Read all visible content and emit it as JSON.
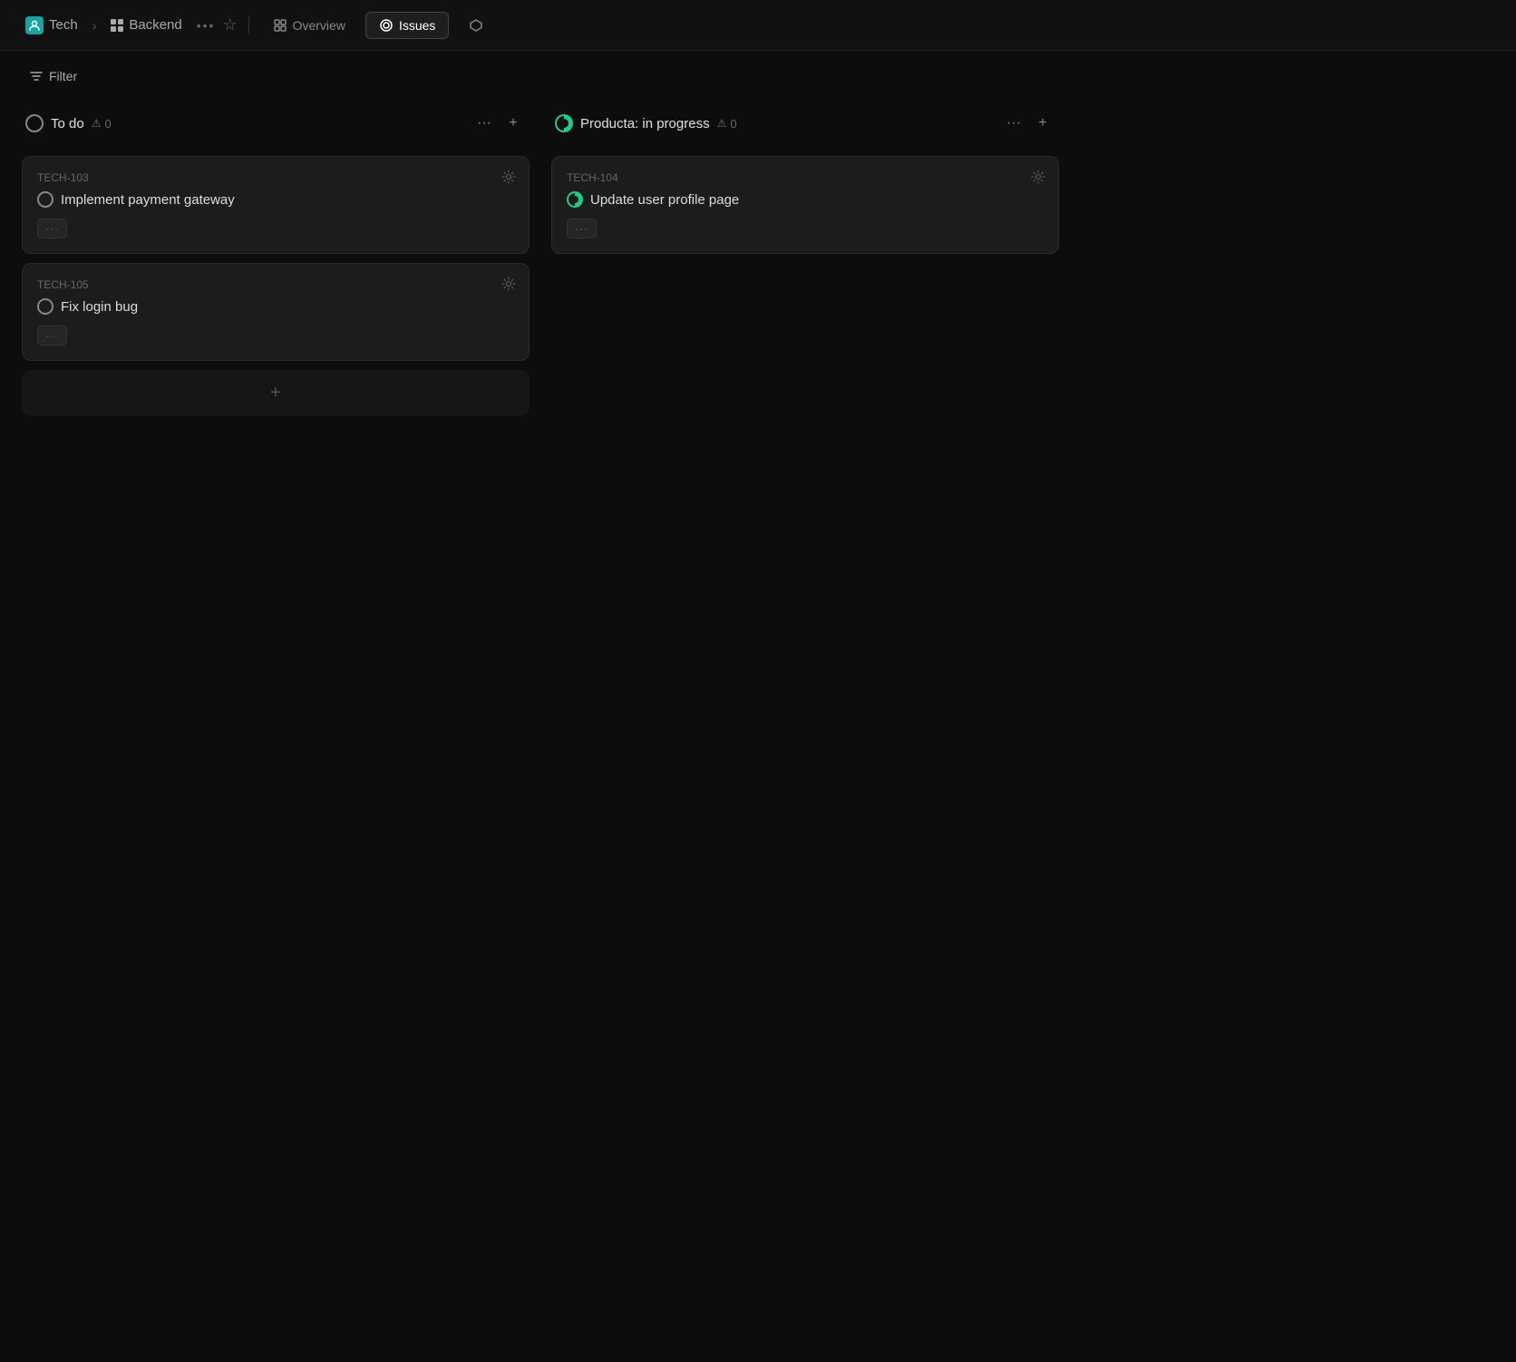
{
  "nav": {
    "team_icon": "T",
    "team_label": "Tech",
    "project_label": "Backend",
    "more_label": "•••",
    "star_label": "☆",
    "overview_label": "Overview",
    "issues_label": "Issues",
    "deploy_label": "⬡"
  },
  "filter": {
    "label": "Filter",
    "icon": "≡"
  },
  "columns": [
    {
      "id": "todo",
      "status_type": "circle",
      "title": "To do",
      "warning_count": "0",
      "cards": [
        {
          "id": "TECH-103",
          "status_type": "circle",
          "title": "Implement payment gateway",
          "meta": "···"
        },
        {
          "id": "TECH-105",
          "status_type": "circle",
          "title": "Fix login bug",
          "meta": "···"
        }
      ]
    },
    {
      "id": "in-progress",
      "status_type": "progress",
      "title": "Producta: in progress",
      "warning_count": "0",
      "cards": [
        {
          "id": "TECH-104",
          "status_type": "progress",
          "title": "Update user profile page",
          "meta": "···"
        }
      ]
    }
  ]
}
